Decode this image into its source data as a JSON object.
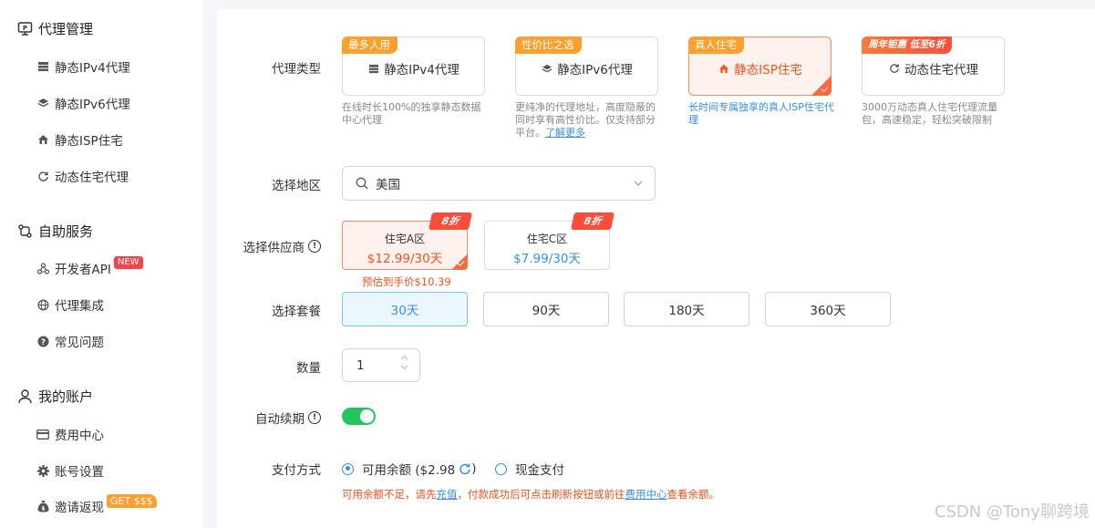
{
  "sidebar": {
    "sections": [
      {
        "label": "代理管理",
        "icon": "monitor-icon"
      },
      {
        "label": "自助服务",
        "icon": "route-icon"
      },
      {
        "label": "我的账户",
        "icon": "user-icon"
      }
    ],
    "items": [
      {
        "label": "静态IPv4代理",
        "icon": "server-icon"
      },
      {
        "label": "静态IPv6代理",
        "icon": "layers-icon"
      },
      {
        "label": "静态ISP住宅",
        "icon": "home-icon"
      },
      {
        "label": "动态住宅代理",
        "icon": "refresh-icon"
      },
      {
        "label": "开发者API",
        "icon": "nodes-icon",
        "badge": "NEW"
      },
      {
        "label": "代理集成",
        "icon": "globe-icon"
      },
      {
        "label": "常见问题",
        "icon": "question-icon"
      },
      {
        "label": "费用中心",
        "icon": "card-icon"
      },
      {
        "label": "账号设置",
        "icon": "gear-icon"
      },
      {
        "label": "邀请返现",
        "icon": "moneybag-icon",
        "badge": "GET $$$"
      }
    ]
  },
  "labels": {
    "proxy_type": "代理类型",
    "region": "选择地区",
    "supplier": "选择供应商",
    "package": "选择套餐",
    "quantity": "数量",
    "auto_renew": "自动续期",
    "payment": "支付方式"
  },
  "proxy_types": [
    {
      "tag": "最多人用",
      "label": "静态IPv4代理",
      "icon": "server-icon",
      "desc": "在线时长100%的独享静态数据中心代理",
      "tag_color": "#ff9f2d",
      "selected": false
    },
    {
      "tag": "性价比之选",
      "label": "静态IPv6代理",
      "icon": "layers-icon",
      "desc": "更纯净的代理地址，高度隐蔽的同时享有高性价比。仅支持部分平台。",
      "link": "了解更多",
      "tag_color": "#ff9f2d",
      "selected": false
    },
    {
      "tag": "真人住宅",
      "label": "静态ISP住宅",
      "icon": "home-icon",
      "desc": "长时间专属独享的真人ISP住宅代理",
      "tag_color": "#ff9f2d",
      "selected": true
    },
    {
      "tag": "周年钜惠 低至6折",
      "label": "动态住宅代理",
      "icon": "refresh-icon",
      "desc": "3000万动态真人住宅代理流量包，高速稳定，轻松突破限制",
      "tag_color": "#ff5a3c",
      "selected": false
    }
  ],
  "region": {
    "value": "美国"
  },
  "suppliers": [
    {
      "name": "住宅A区",
      "price": "$12.99/30天",
      "discount": "8折",
      "selected": true
    },
    {
      "name": "住宅C区",
      "price": "$7.99/30天",
      "discount": "8折",
      "selected": false
    }
  ],
  "estimate": "预估到手价$10.39",
  "packages": [
    {
      "label": "30天",
      "selected": true
    },
    {
      "label": "90天",
      "selected": false
    },
    {
      "label": "180天",
      "selected": false
    },
    {
      "label": "360天",
      "selected": false
    }
  ],
  "quantity": "1",
  "auto_renew": true,
  "payment": {
    "balance_label": "可用余额 ($2.98",
    "balance_close": ")",
    "cash_label": "现金支付",
    "note_prefix": "可用余额不足，请先",
    "note_link1": "充值",
    "note_mid": "，付款成功后可点击刷新按钮或前往",
    "note_link2": "费用中心",
    "note_suffix": "查看余额。"
  },
  "watermark": "CSDN @Tony聊跨境",
  "colors": {
    "accent": "#3a8ee6",
    "orange": "#f4511e",
    "toggle": "#22c55e"
  }
}
